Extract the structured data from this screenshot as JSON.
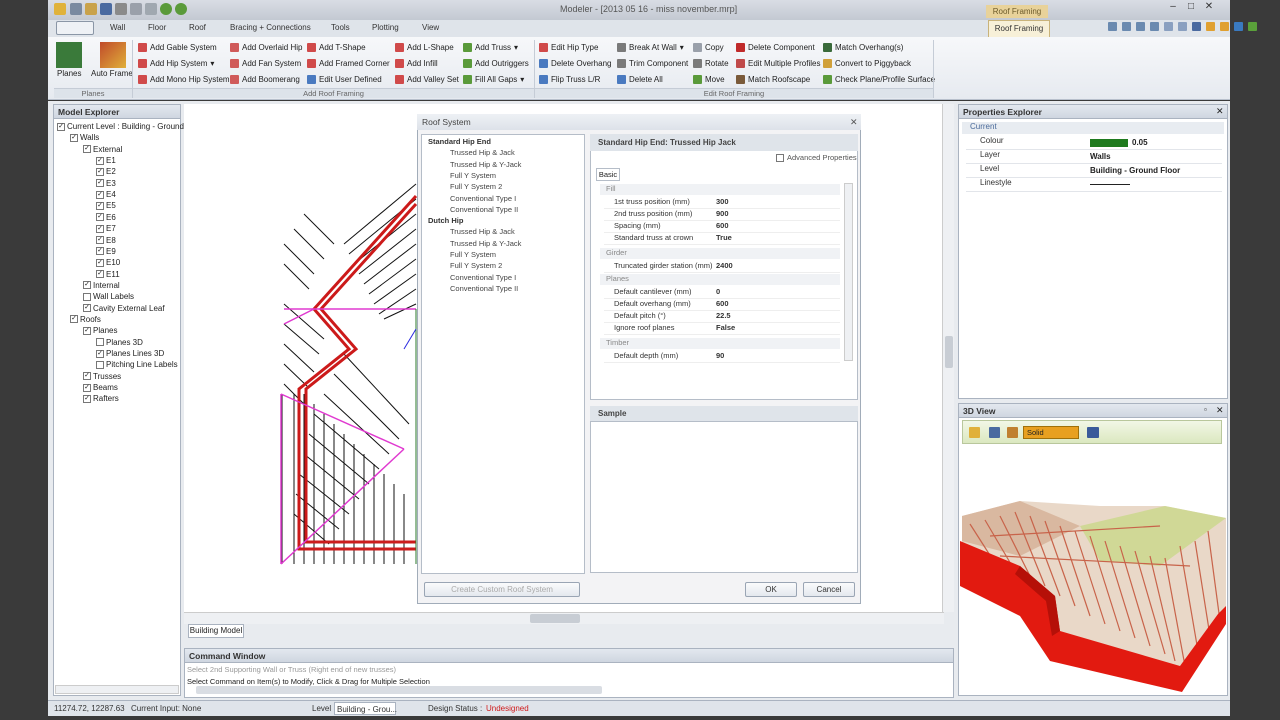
{
  "window": {
    "title": "Modeler - [2013 05 16 - miss november.mrp]",
    "context_tab": "Roof Framing"
  },
  "ribbon": {
    "tabs": [
      "Wall",
      "Floor",
      "Roof",
      "Bracing + Connections",
      "Tools",
      "Plotting",
      "View"
    ],
    "active_tab": "Roof Framing",
    "big_buttons": {
      "planes": "Planes",
      "auto_frame": "Auto Frame"
    },
    "col1": [
      "Add Gable System",
      "Add Hip System",
      "Add Mono Hip System"
    ],
    "col2": [
      "Add Overlaid Hip",
      "Add Fan System",
      "Add Boomerang"
    ],
    "col3": [
      "Add T-Shape",
      "Add Framed Corner",
      "Edit User Defined"
    ],
    "col4": [
      "Add L-Shape",
      "Add Infill",
      "Add Valley Set"
    ],
    "col5": [
      "Add Truss",
      "Add Outriggers",
      "Fill All Gaps"
    ],
    "col6": [
      "Edit Hip Type",
      "Delete Overhang",
      "Flip Truss L/R"
    ],
    "col7": [
      "Break At Wall",
      "Trim Component",
      "Delete All"
    ],
    "col8": [
      "Copy",
      "Rotate",
      "Move"
    ],
    "col9": [
      "Delete Component",
      "Edit Multiple Profiles",
      "Match Roofscape"
    ],
    "col10": [
      "Match Overhang(s)",
      "Convert to Piggyback",
      "Check Plane/Profile Surface"
    ],
    "groups": {
      "planes": "Planes",
      "add": "Add Roof Framing",
      "edit": "Edit Roof Framing"
    }
  },
  "explorer": {
    "title": "Model Explorer",
    "items": [
      {
        "label": "Current Level : Building - Ground",
        "checked": true
      },
      {
        "label": "Walls",
        "checked": true
      },
      {
        "label": "External",
        "checked": true
      },
      {
        "label": "E1",
        "checked": true
      },
      {
        "label": "E2",
        "checked": true
      },
      {
        "label": "E3",
        "checked": true
      },
      {
        "label": "E4",
        "checked": true
      },
      {
        "label": "E5",
        "checked": true
      },
      {
        "label": "E6",
        "checked": true
      },
      {
        "label": "E7",
        "checked": true
      },
      {
        "label": "E8",
        "checked": true
      },
      {
        "label": "E9",
        "checked": true
      },
      {
        "label": "E10",
        "checked": true
      },
      {
        "label": "E11",
        "checked": true
      },
      {
        "label": "Internal",
        "checked": true
      },
      {
        "label": "Wall Labels",
        "checked": false
      },
      {
        "label": "Cavity External Leaf",
        "checked": true
      },
      {
        "label": "Roofs",
        "checked": true
      },
      {
        "label": "Planes",
        "checked": true
      },
      {
        "label": "Planes 3D",
        "checked": false
      },
      {
        "label": "Planes Lines 3D",
        "checked": true
      },
      {
        "label": "Pitching Line Labels",
        "checked": false
      },
      {
        "label": "Trusses",
        "checked": true
      },
      {
        "label": "Beams",
        "checked": true
      },
      {
        "label": "Rafters",
        "checked": true
      }
    ]
  },
  "dialog": {
    "title": "Roof System",
    "tree": [
      {
        "label": "Standard Hip End",
        "bold": true
      },
      {
        "label": "Trussed Hip & Jack",
        "bold": false
      },
      {
        "label": "Trussed Hip & Y-Jack",
        "bold": false
      },
      {
        "label": "Full Y System",
        "bold": false
      },
      {
        "label": "Full Y System 2",
        "bold": false
      },
      {
        "label": "Conventional Type I",
        "bold": false
      },
      {
        "label": "Conventional Type II",
        "bold": false
      },
      {
        "label": "Dutch Hip",
        "bold": true
      },
      {
        "label": "Trussed Hip & Jack",
        "bold": false
      },
      {
        "label": "Trussed Hip & Y-Jack",
        "bold": false
      },
      {
        "label": "Full Y System",
        "bold": false
      },
      {
        "label": "Full Y System 2",
        "bold": false
      },
      {
        "label": "Conventional Type I",
        "bold": false
      },
      {
        "label": "Conventional Type II",
        "bold": false
      }
    ],
    "header": "Standard Hip End: Trussed Hip Jack",
    "advanced": "Advanced Properties",
    "basic_tab": "Basic",
    "categories": {
      "fill": "Fill",
      "girder": "Girder",
      "planes": "Planes",
      "timber": "Timber"
    },
    "props": [
      {
        "k": "1st truss position (mm)",
        "v": "300"
      },
      {
        "k": "2nd truss position (mm)",
        "v": "900"
      },
      {
        "k": "Spacing (mm)",
        "v": "600"
      },
      {
        "k": "Standard truss at crown",
        "v": "True"
      },
      {
        "k": "Truncated girder station (mm)",
        "v": "2400"
      },
      {
        "k": "Default cantilever (mm)",
        "v": "0"
      },
      {
        "k": "Default overhang (mm)",
        "v": "600"
      },
      {
        "k": "Default pitch (°)",
        "v": "22.5"
      },
      {
        "k": "Ignore roof planes",
        "v": "False"
      },
      {
        "k": "Default depth (mm)",
        "v": "90"
      }
    ],
    "sample": "Sample",
    "create_btn": "Create Custom Roof System",
    "ok": "OK",
    "cancel": "Cancel"
  },
  "properties": {
    "title": "Properties Explorer",
    "section": "Current",
    "rows": [
      {
        "k": "Colour",
        "v": "0.05"
      },
      {
        "k": "Layer",
        "v": "Walls"
      },
      {
        "k": "Level",
        "v": "Building - Ground Floor"
      },
      {
        "k": "Linestyle",
        "v": ""
      }
    ],
    "colour_swatch": "#1e7a1e"
  },
  "view3d": {
    "title": "3D View",
    "mode": "Solid"
  },
  "doc_tab": "Building Model",
  "command": {
    "title": "Command Window",
    "line1": "Select 2nd Supporting Wall or Truss (Right end of new trusses)",
    "line2": "Select Command on Item(s) to Modify, Click & Drag for Multiple Selection"
  },
  "status": {
    "coords": "11274.72, 12287.63",
    "current_input": "Current Input: None",
    "level_label": "Level",
    "level_value": "Building - Grou...",
    "design_status_label": "Design Status :",
    "design_status_value": "Undesigned"
  }
}
